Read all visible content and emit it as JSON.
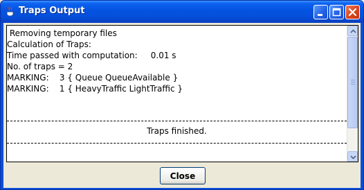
{
  "window": {
    "title": "Traps Output"
  },
  "output": {
    "lines": [
      " Removing temporary files",
      "Calculation of Traps:",
      "Time passed with computation:     0.01 s",
      "No. of traps = 2",
      "MARKING:    3 { Queue QueueAvailable }",
      "MARKING:    1 { HeavyTraffic LightTraffic }"
    ],
    "status": "Traps finished."
  },
  "buttons": {
    "close_label": "Close"
  },
  "icons": {
    "app": "java-coffee-cup-icon",
    "minimize": "minimize-icon",
    "maximize": "maximize-icon",
    "close": "close-icon"
  },
  "colors": {
    "titlebar": "#0552e0",
    "close_button": "#d9441c",
    "background": "#ece9d8"
  }
}
